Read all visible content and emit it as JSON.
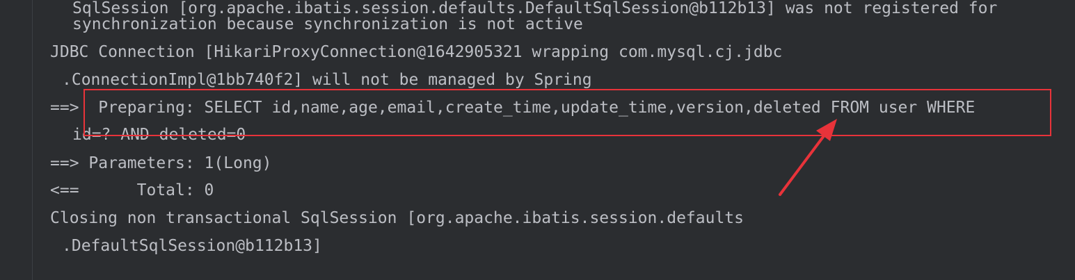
{
  "console": {
    "lines": [
      "SqlSession [org.apache.ibatis.session.defaults.DefaultSqlSession@b112b13] was not registered for",
      "synchronization because synchronization is not active",
      "JDBC Connection [HikariProxyConnection@1642905321 wrapping com.mysql.cj.jdbc",
      ".ConnectionImpl@1bb740f2] will not be managed by Spring",
      "==>  Preparing: SELECT id,name,age,email,create_time,update_time,version,deleted FROM user WHERE",
      "id=? AND deleted=0",
      "==> Parameters: 1(Long)",
      "<==      Total: 0",
      "Closing non transactional SqlSession [org.apache.ibatis.session.defaults",
      ".DefaultSqlSession@b112b13]"
    ]
  },
  "annotation": {
    "color": "#e8333a"
  },
  "colors": {
    "background": "#2b2d30",
    "text": "#bcbec4"
  }
}
